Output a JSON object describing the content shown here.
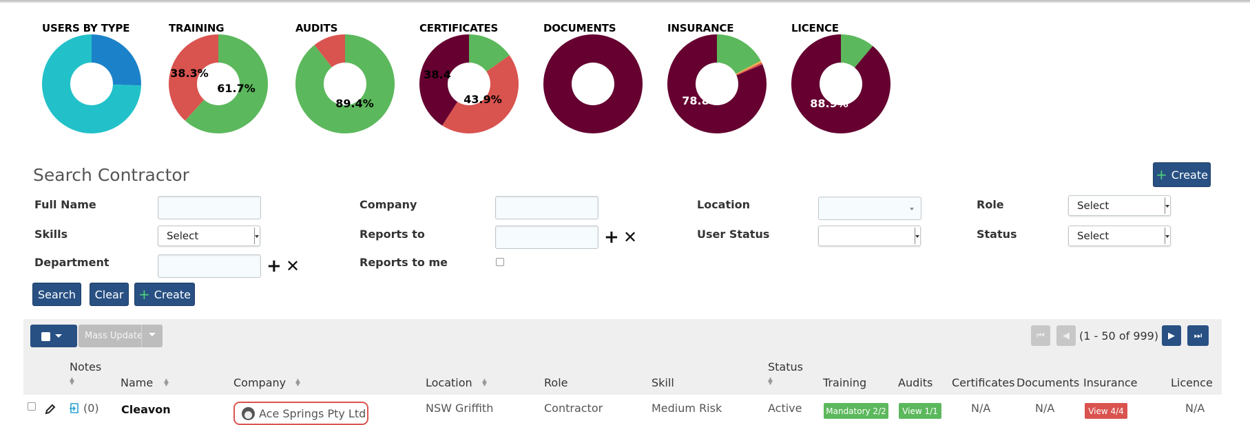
{
  "chart_data": [
    {
      "type": "pie",
      "title": "USERS BY TYPE",
      "slices": [
        {
          "value": 25.5,
          "color": "#1b82c9"
        },
        {
          "value": 74.5,
          "color": "#22c1c9",
          "label": "74.5%"
        }
      ],
      "label_color": "#000"
    },
    {
      "type": "pie",
      "title": "TRAINING",
      "slices": [
        {
          "value": 61.7,
          "color": "#5cb85c",
          "label": "61.7%"
        },
        {
          "value": 38.3,
          "color": "#d9534f",
          "label": "38.3%"
        }
      ],
      "label_color": "#000"
    },
    {
      "type": "pie",
      "title": "AUDITS",
      "slices": [
        {
          "value": 89.4,
          "color": "#5cb85c",
          "label": "89.4%"
        },
        {
          "value": 10.6,
          "color": "#d9534f"
        }
      ],
      "label_color": "#000"
    },
    {
      "type": "pie",
      "title": "CERTIFICATES",
      "slices": [
        {
          "value": 15.2,
          "color": "#5cb85c"
        },
        {
          "value": 43.9,
          "color": "#d9534f",
          "label": "43.9%"
        },
        {
          "value": 40.9,
          "color": "#650030",
          "label": "38.4"
        }
      ],
      "label_color": "#000"
    },
    {
      "type": "pie",
      "title": "DOCUMENTS",
      "slices": [
        {
          "value": 100,
          "color": "#650030"
        }
      ],
      "label_color": "#fff"
    },
    {
      "type": "pie",
      "title": "INSURANCE",
      "slices": [
        {
          "value": 16.7,
          "color": "#5cb85c"
        },
        {
          "value": 0.6,
          "color": "#f0ad4e"
        },
        {
          "value": 0.6,
          "color": "#d9534f"
        },
        {
          "value": 78.8,
          "color": "#650030",
          "label": "78.8%"
        }
      ],
      "label_color": "#fff"
    },
    {
      "type": "pie",
      "title": "LICENCE",
      "slices": [
        {
          "value": 11.1,
          "color": "#5cb85c"
        },
        {
          "value": 88.9,
          "color": "#650030",
          "label": "88.9%"
        }
      ],
      "label_color": "#fff"
    }
  ],
  "search": {
    "title": "Search Contractor",
    "create_top": "Create",
    "fields": {
      "full_name": "Full Name",
      "company": "Company",
      "location": "Location",
      "role": "Role",
      "skills": "Skills",
      "reports_to": "Reports to",
      "user_status": "User Status",
      "status": "Status",
      "department": "Department",
      "reports_to_me": "Reports to me"
    },
    "select_placeholder": "Select",
    "buttons": {
      "search": "Search",
      "clear": "Clear",
      "create": "Create"
    }
  },
  "toolbar": {
    "mass_update": "Mass Update",
    "pagination": "(1 - 50 of 999)"
  },
  "table": {
    "headers": {
      "notes": "Notes",
      "name": "Name",
      "company": "Company",
      "location": "Location",
      "role": "Role",
      "skill": "Skill",
      "status": "Status",
      "training": "Training",
      "audits": "Audits",
      "certificates": "Certificates",
      "documents": "Documents",
      "insurance": "Insurance",
      "licence": "Licence"
    },
    "rows": [
      {
        "notes": "(0)",
        "name": "Cleavon",
        "company": "Ace Springs Pty Ltd",
        "location": "NSW Griffith",
        "role": "Contractor",
        "skill": "Medium Risk",
        "status": "Active",
        "training": "Mandatory 2/2",
        "audits": "View 1/1",
        "certificates": "N/A",
        "documents": "N/A",
        "insurance": "View 4/4",
        "licence": "N/A"
      }
    ]
  },
  "colors": {
    "primary": "#285083",
    "success": "#5cb85c",
    "danger": "#d9534f",
    "maroon": "#650030",
    "teal": "#22c1c9",
    "blue": "#1b82c9"
  }
}
